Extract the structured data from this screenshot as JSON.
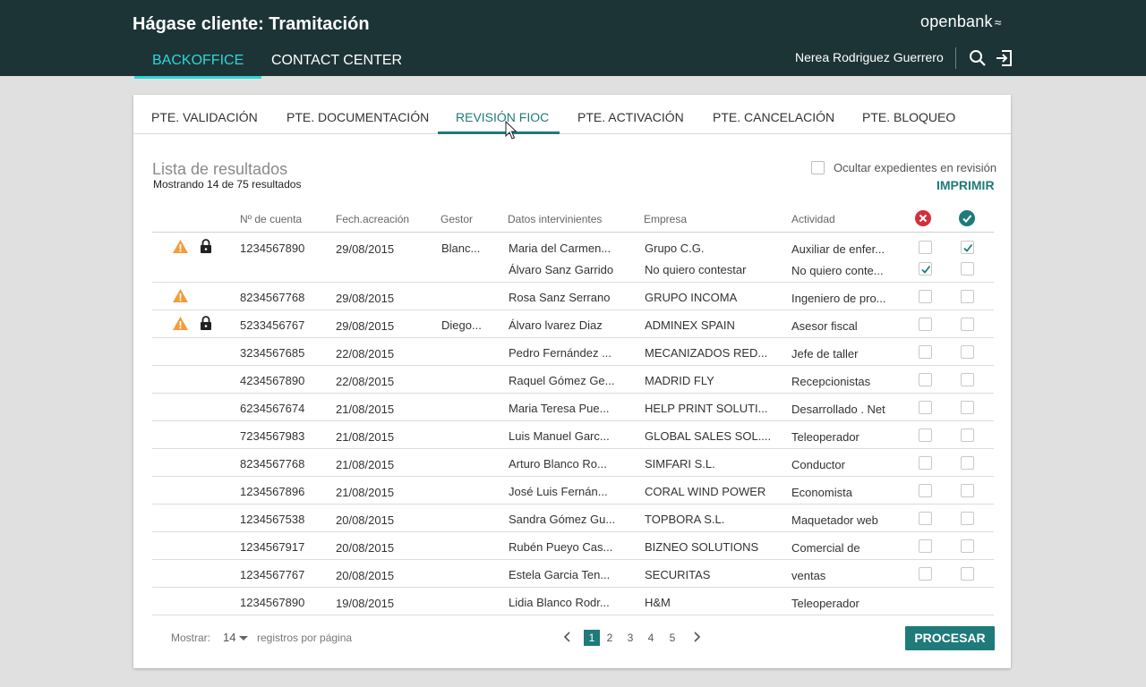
{
  "header": {
    "title": "Hágase cliente: Tramitación",
    "brand": "openbank",
    "nav_tabs": [
      {
        "label": "BACKOFFICE",
        "active": true
      },
      {
        "label": "CONTACT CENTER",
        "active": false
      }
    ],
    "user_name": "Nerea Rodriguez Guerrero",
    "icons": [
      "search-icon",
      "logout-icon"
    ]
  },
  "tabs": [
    {
      "label": "PTE. VALIDACIÓN",
      "active": false
    },
    {
      "label": "PTE. DOCUMENTACIÓN",
      "active": false
    },
    {
      "label": "REVISIÓN FIOC",
      "active": true
    },
    {
      "label": "PTE. ACTIVACIÓN",
      "active": false
    },
    {
      "label": "PTE. CANCELACIÓN",
      "active": false
    },
    {
      "label": "PTE. BLOQUEO",
      "active": false
    }
  ],
  "results": {
    "title": "Lista de resultados",
    "count_text": "Mostrando 14 de 75 resultados",
    "hide_in_review_label": "Ocultar expedientes en revisión",
    "hide_in_review_checked": false,
    "print_label": "IMPRIMIR"
  },
  "table": {
    "headers": {
      "account": "Nº de cuenta",
      "created": "Fech.acreación",
      "manager": "Gestor",
      "participants": "Datos intervinientes",
      "company": "Empresa",
      "activity": "Actividad",
      "reject_icon": "reject-icon",
      "approve_icon": "approve-icon"
    },
    "rows": [
      {
        "warning": true,
        "locked": true,
        "account": "1234567890",
        "date": "29/08/2015",
        "manager": "Blanc...",
        "lines": [
          {
            "participant": "Maria del Carmen...",
            "company": "Grupo C.G.",
            "activity": "Auxiliar de enfer...",
            "reject": false,
            "approve": true
          },
          {
            "participant": "Álvaro Sanz Garrido",
            "company": "No quiero contestar",
            "activity": "No quiero conte...",
            "reject": true,
            "approve": false
          }
        ]
      },
      {
        "warning": true,
        "locked": false,
        "account": "8234567768",
        "date": "29/08/2015",
        "manager": "",
        "lines": [
          {
            "participant": "Rosa Sanz Serrano",
            "company": "GRUPO INCOMA",
            "activity": "Ingeniero de pro...",
            "reject": false,
            "approve": false
          }
        ]
      },
      {
        "warning": true,
        "locked": true,
        "account": "5233456767",
        "date": "29/08/2015",
        "manager": "Diego...",
        "lines": [
          {
            "participant": "Álvaro lvarez Diaz",
            "company": "ADMINEX SPAIN",
            "activity": "Asesor fiscal",
            "reject": false,
            "approve": false
          }
        ]
      },
      {
        "warning": false,
        "locked": false,
        "account": "3234567685",
        "date": "22/08/2015",
        "manager": "",
        "lines": [
          {
            "participant": "Pedro Fernández ...",
            "company": "MECANIZADOS RED...",
            "activity": "Jefe de taller",
            "reject": false,
            "approve": false
          }
        ]
      },
      {
        "warning": false,
        "locked": false,
        "account": "4234567890",
        "date": "22/08/2015",
        "manager": "",
        "lines": [
          {
            "participant": "Raquel Gómez Ge...",
            "company": "MADRID FLY",
            "activity": "Recepcionistas",
            "reject": false,
            "approve": false
          }
        ]
      },
      {
        "warning": false,
        "locked": false,
        "account": "6234567674",
        "date": "21/08/2015",
        "manager": "",
        "lines": [
          {
            "participant": "Maria Teresa Pue...",
            "company": "HELP PRINT SOLUTI...",
            "activity": "Desarrollado . Net",
            "reject": false,
            "approve": false
          }
        ]
      },
      {
        "warning": false,
        "locked": false,
        "account": "7234567983",
        "date": "21/08/2015",
        "manager": "",
        "lines": [
          {
            "participant": "Luis Manuel Garc...",
            "company": "GLOBAL SALES SOL....",
            "activity": "Teleoperador",
            "reject": false,
            "approve": false
          }
        ]
      },
      {
        "warning": false,
        "locked": false,
        "account": "8234567768",
        "date": "21/08/2015",
        "manager": "",
        "lines": [
          {
            "participant": "Arturo Blanco Ro...",
            "company": "SIMFARI S.L.",
            "activity": "Conductor",
            "reject": false,
            "approve": false
          }
        ]
      },
      {
        "warning": false,
        "locked": false,
        "account": "1234567896",
        "date": "21/08/2015",
        "manager": "",
        "lines": [
          {
            "participant": "José Luis Fernán...",
            "company": "CORAL WIND POWER",
            "activity": "Economista",
            "reject": false,
            "approve": false
          }
        ]
      },
      {
        "warning": false,
        "locked": false,
        "account": "1234567538",
        "date": "20/08/2015",
        "manager": "",
        "lines": [
          {
            "participant": "Sandra Gómez Gu...",
            "company": "TOPBORA S.L.",
            "activity": "Maquetador web",
            "reject": false,
            "approve": false
          }
        ]
      },
      {
        "warning": false,
        "locked": false,
        "account": "1234567917",
        "date": "20/08/2015",
        "manager": "",
        "lines": [
          {
            "participant": "Rubén Pueyo Cas...",
            "company": "BIZNEO SOLUTIONS",
            "activity": "Comercial de",
            "reject": false,
            "approve": false
          }
        ]
      },
      {
        "warning": false,
        "locked": false,
        "account": "1234567767",
        "date": "20/08/2015",
        "manager": "",
        "lines": [
          {
            "participant": "Estela Garcia Ten...",
            "company": "SECURITAS",
            "activity": "ventas",
            "reject": false,
            "approve": false
          }
        ]
      },
      {
        "warning": false,
        "locked": false,
        "account": "1234567890",
        "date": "19/08/2015",
        "manager": "",
        "no_checkboxes": true,
        "lines": [
          {
            "participant": "Lidia Blanco Rodr...",
            "company": "H&M",
            "activity": "Teleoperador",
            "reject": false,
            "approve": false
          }
        ]
      }
    ]
  },
  "footer": {
    "show_label": "Mostrar:",
    "page_size": "14",
    "per_page_label": "registros por página",
    "pages": [
      "1",
      "2",
      "3",
      "4",
      "5"
    ],
    "current_page": "1",
    "process_label": "PROCESAR"
  },
  "colors": {
    "header_bg": "#1d3437",
    "accent": "#1f7a7a",
    "active_nav": "#2ed6d6",
    "warning": "#f39c3b",
    "reject": "#d32f3a"
  }
}
